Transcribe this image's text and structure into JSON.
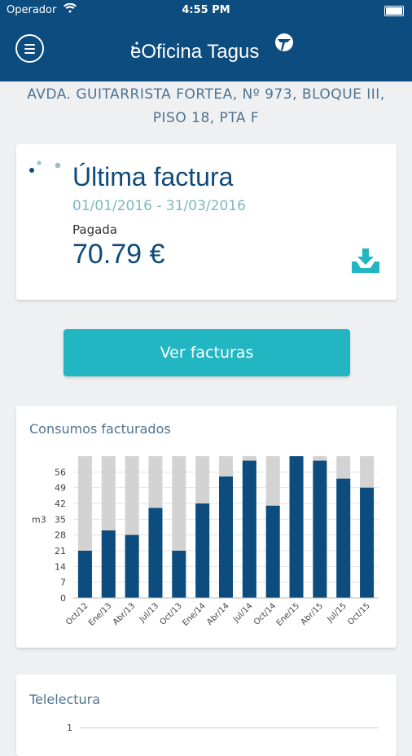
{
  "status_bar": {
    "carrier": "Operador",
    "time": "4:55 PM"
  },
  "header": {
    "title": "eOficina Tagus"
  },
  "address": {
    "line1": "AVDA. GUITARRISTA FORTEA, Nº 973, BLOQUE III,",
    "line2": "PISO 18, PTA F"
  },
  "invoice": {
    "title": "Última factura",
    "period": "01/01/2016 - 31/03/2016",
    "status": "Pagada",
    "amount": "70.79 €"
  },
  "actions": {
    "view_invoices_label": "Ver facturas"
  },
  "consumption": {
    "title": "Consumos facturados",
    "chart_data": {
      "type": "bar",
      "title": "Consumos facturados",
      "ylabel": "m3",
      "ylim": [
        0,
        63
      ],
      "yticks": [
        0,
        7,
        14,
        21,
        28,
        35,
        42,
        49,
        56
      ],
      "categories": [
        "Oct/12",
        "Ene/13",
        "Abr/13",
        "Jul/13",
        "Oct/13",
        "Ene/14",
        "Abr/14",
        "Jul/14",
        "Oct/14",
        "Ene/15",
        "Abr/15",
        "Jul/15",
        "Oct/15"
      ],
      "series": [
        {
          "values": [
            21,
            30,
            28,
            40,
            21,
            42,
            54,
            61,
            41,
            63,
            61,
            53,
            49
          ]
        }
      ],
      "background_max": 63
    }
  },
  "telelectura": {
    "title": "Telelectura",
    "tick": "1"
  },
  "colors": {
    "header": "#0c4c7e",
    "accent": "#22b6c3",
    "bar": "#0c4c7e",
    "bar_bg": "#d3d3d3"
  }
}
